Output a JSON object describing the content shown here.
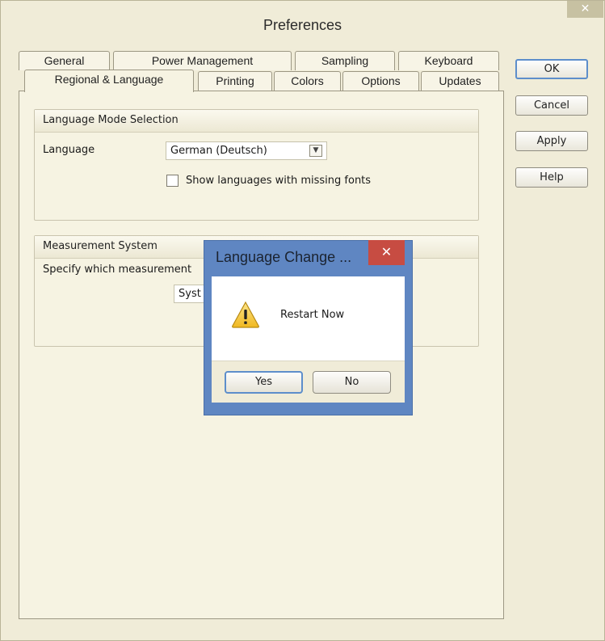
{
  "window": {
    "title": "Preferences",
    "close_glyph": "✕"
  },
  "tabs": {
    "row_back": [
      {
        "label": "General"
      },
      {
        "label": "Power Management"
      },
      {
        "label": "Sampling"
      },
      {
        "label": "Keyboard"
      }
    ],
    "row_front": [
      {
        "label": "Regional & Language",
        "active": true
      },
      {
        "label": "Printing"
      },
      {
        "label": "Colors"
      },
      {
        "label": "Options"
      },
      {
        "label": "Updates"
      }
    ]
  },
  "language_group": {
    "header": "Language Mode Selection",
    "language_label": "Language",
    "language_value": "German (Deutsch)",
    "missing_fonts_label": "Show languages with missing fonts",
    "missing_fonts_checked": false
  },
  "measurement_group": {
    "header": "Measurement System",
    "specify_label": "Specify which measurement",
    "system_value": "Syst"
  },
  "buttons": {
    "ok": "OK",
    "cancel": "Cancel",
    "apply": "Apply",
    "help": "Help"
  },
  "dialog": {
    "title": "Language Change ...",
    "close_glyph": "✕",
    "message": "Restart Now",
    "icon": "warning-icon",
    "yes": "Yes",
    "no": "No"
  },
  "colors": {
    "window_bg": "#f0ecd8",
    "dialog_frame": "#5f86c2",
    "dialog_close": "#c74c42",
    "default_button_border": "#5d8ecb"
  }
}
